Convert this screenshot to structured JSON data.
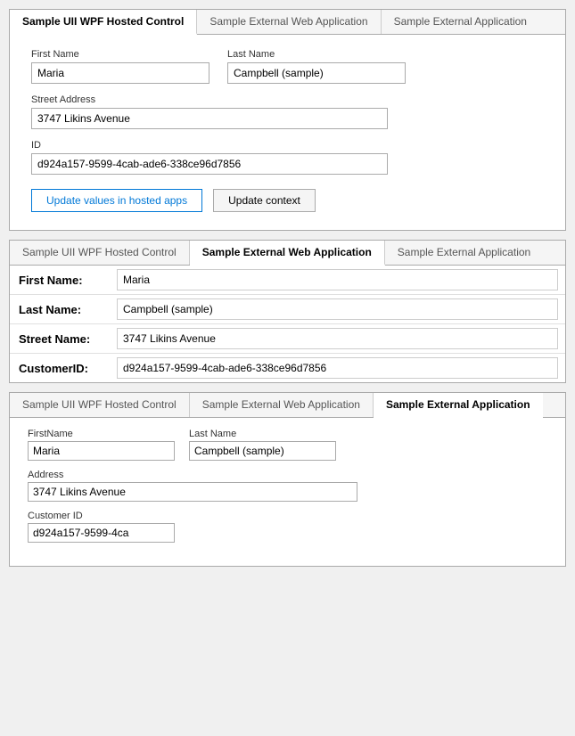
{
  "panel1": {
    "tabs": [
      {
        "label": "Sample UII WPF Hosted Control",
        "active": true
      },
      {
        "label": "Sample External Web Application",
        "active": false
      },
      {
        "label": "Sample External Application",
        "active": false
      }
    ],
    "fields": {
      "first_name_label": "First Name",
      "first_name_value": "Maria",
      "last_name_label": "Last Name",
      "last_name_value": "Campbell (sample)",
      "street_label": "Street Address",
      "street_value": "3747 Likins Avenue",
      "id_label": "ID",
      "id_value": "d924a157-9599-4cab-ade6-338ce96d7856"
    },
    "buttons": {
      "update_hosted": "Update values in hosted apps",
      "update_context": "Update context"
    }
  },
  "panel2": {
    "tabs": [
      {
        "label": "Sample UII WPF Hosted Control",
        "active": false
      },
      {
        "label": "Sample External Web Application",
        "active": true
      },
      {
        "label": "Sample External Application",
        "active": false
      }
    ],
    "rows": [
      {
        "label": "First Name:",
        "value": "Maria"
      },
      {
        "label": "Last Name:",
        "value": "Campbell (sample)"
      },
      {
        "label": "Street Name:",
        "value": "3747 Likins Avenue"
      },
      {
        "label": "CustomerID:",
        "value": "d924a157-9599-4cab-ade6-338ce96d7856"
      }
    ]
  },
  "panel3": {
    "tabs": [
      {
        "label": "Sample UII WPF Hosted Control",
        "active": false
      },
      {
        "label": "Sample External Web Application",
        "active": false
      },
      {
        "label": "Sample External Application",
        "active": true
      }
    ],
    "fields": {
      "first_name_label": "FirstName",
      "first_name_value": "Maria",
      "last_name_label": "Last Name",
      "last_name_value": "Campbell (sample)",
      "address_label": "Address",
      "address_value": "3747 Likins Avenue",
      "customer_id_label": "Customer ID",
      "customer_id_value": "d924a157-9599-4ca"
    }
  }
}
